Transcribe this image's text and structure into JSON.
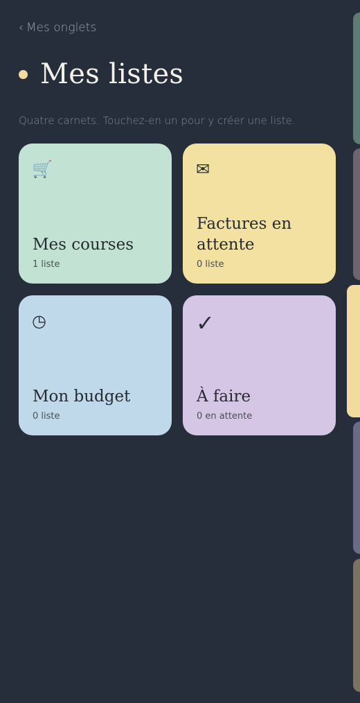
{
  "nav": {
    "back_chevron": "‹",
    "back_label": "Mes onglets"
  },
  "header": {
    "title": "Mes listes",
    "subtitle": "Quatre carnets. Touchez-en un pour y créer une liste.",
    "dot_color": "#f2dc9c"
  },
  "cards": [
    {
      "title": "Mes courses",
      "count": "1 liste",
      "icon": "🛒",
      "icon_name": "shopping-cart-icon",
      "color": "#c2e2d3"
    },
    {
      "title": "Factures en attente",
      "count": "0 liste",
      "icon": "✉",
      "icon_name": "envelope-icon",
      "color": "#f2e1a1"
    },
    {
      "title": "Mon budget",
      "count": "0 liste",
      "icon": "◷",
      "icon_name": "clock-icon",
      "color": "#bfd9eb"
    },
    {
      "title": "À faire",
      "count": "0 en attente",
      "icon": "✓",
      "icon_name": "checkmark-icon",
      "color": "#d6c6e6"
    }
  ],
  "side_tabs": [
    {
      "color": "#5e7b76"
    },
    {
      "color": "#6e6470"
    },
    {
      "color": "#f2dc9c"
    },
    {
      "color": "#6c6a85"
    },
    {
      "color": "#7b7264"
    }
  ],
  "colors": {
    "background": "#252e3a",
    "title_text": "#f4f1ea",
    "muted_text": "#7f8894"
  }
}
